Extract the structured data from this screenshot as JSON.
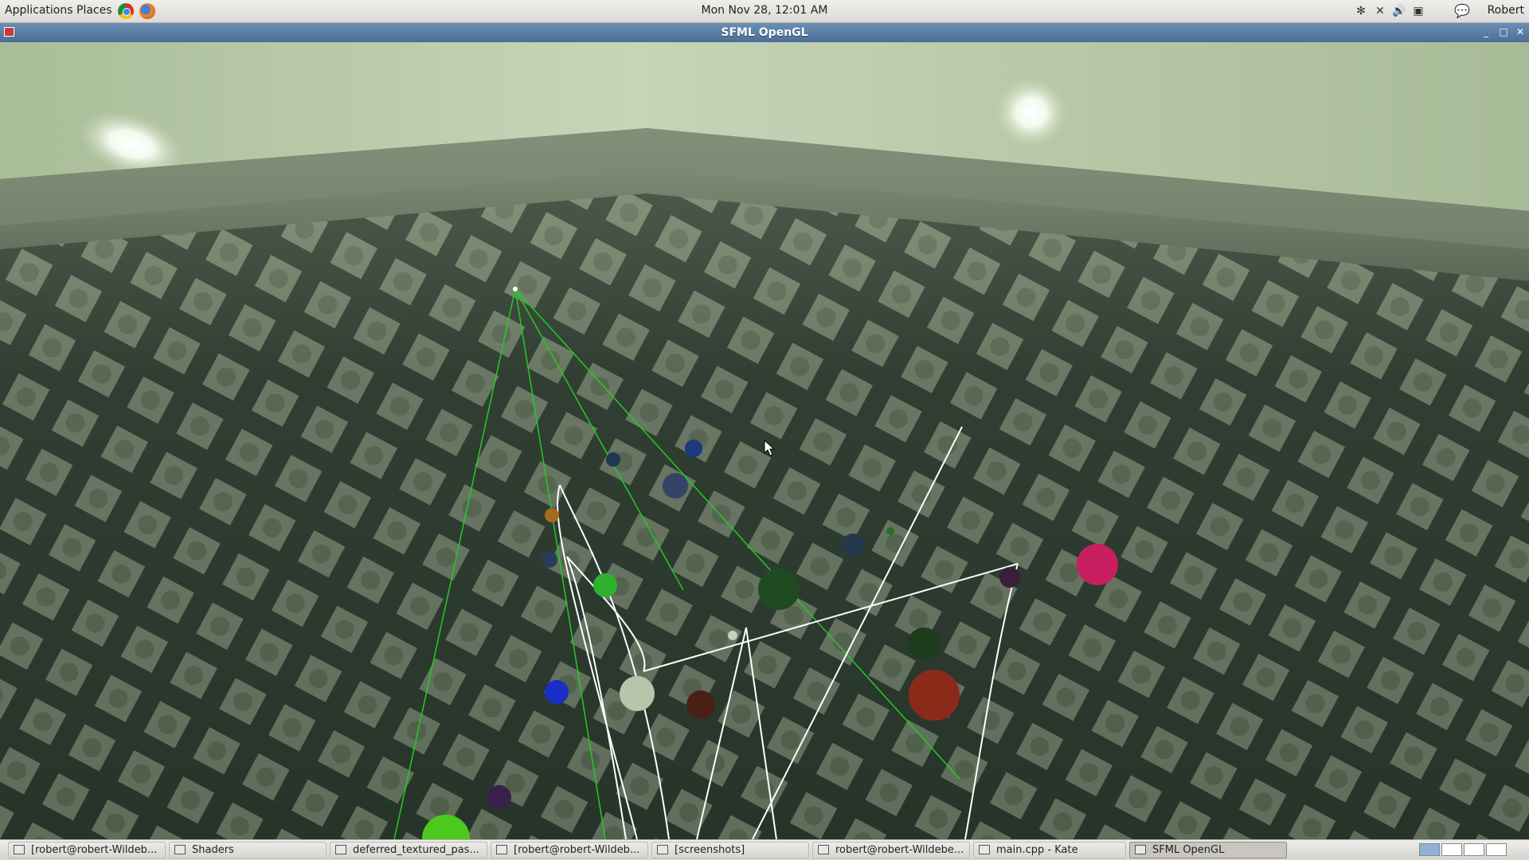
{
  "top_panel": {
    "applications_label": "Applications",
    "places_label": "Places",
    "clock": "Mon Nov 28, 12:01 AM",
    "user": "Robert"
  },
  "window": {
    "title": "SFML OpenGL"
  },
  "colors": {
    "floor_tile": "#aab89c",
    "wall": "#b6c7a8",
    "green_line": "#22cc22",
    "white_line": "#ffffff"
  },
  "taskbar": {
    "items": [
      {
        "label": "[robert@robert-Wildeb...",
        "icon": "terminal-icon"
      },
      {
        "label": "Shaders",
        "icon": "folder-icon"
      },
      {
        "label": "deferred_textured_pas...",
        "icon": "text-editor-icon"
      },
      {
        "label": "[robert@robert-Wildeb...",
        "icon": "terminal-icon"
      },
      {
        "label": "[screenshots]",
        "icon": "folder-icon"
      },
      {
        "label": "robert@robert-Wildebe...",
        "icon": "terminal-icon"
      },
      {
        "label": "main.cpp - Kate",
        "icon": "kate-icon"
      },
      {
        "label": "SFML OpenGL",
        "icon": "window-icon"
      }
    ]
  }
}
